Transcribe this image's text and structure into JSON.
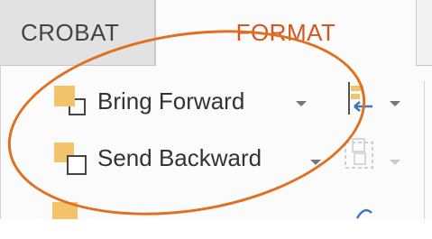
{
  "tabs": {
    "acrobat": "CROBAT",
    "format": "FORMAT"
  },
  "arrange": {
    "bring_forward": "Bring Forward",
    "send_backward": "Send Backward"
  },
  "icons": {
    "bring_forward": "bring-forward-icon",
    "send_backward": "send-backward-icon",
    "align": "align-icon",
    "group": "group-icon"
  },
  "colors": {
    "accent": "#d3561f",
    "annotation": "#e0701f",
    "shape_fill": "#f2c36b"
  }
}
